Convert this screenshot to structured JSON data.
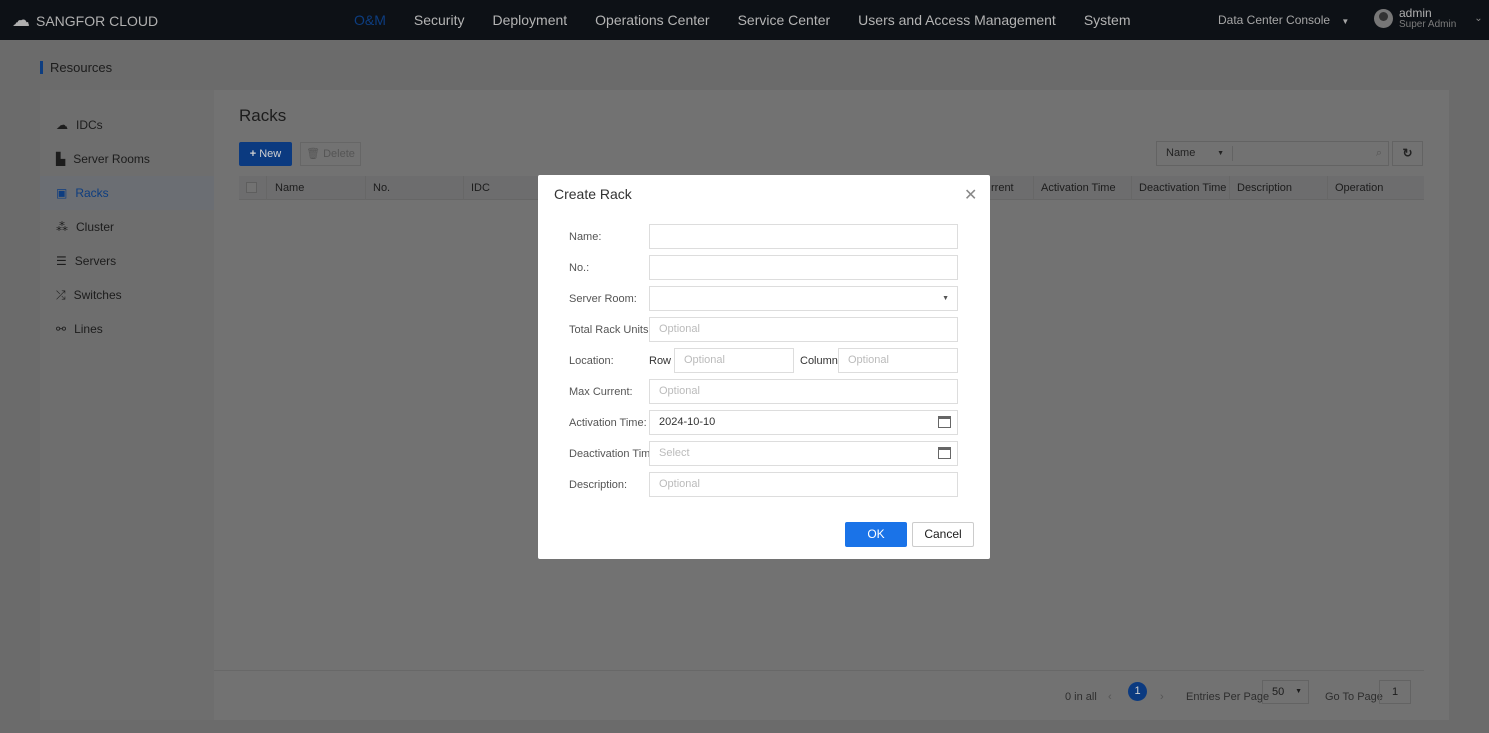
{
  "header": {
    "brand": "SANGFOR CLOUD",
    "nav": [
      "O&M",
      "Security",
      "Deployment",
      "Operations Center",
      "Service Center",
      "Users and Access Management",
      "System"
    ],
    "active_nav": "O&M",
    "console": "Data Center Console",
    "user": {
      "name": "admin",
      "role": "Super Admin"
    }
  },
  "breadcrumb": "Resources",
  "sidebar": {
    "items": [
      {
        "label": "IDCs",
        "icon": "cloud-icon"
      },
      {
        "label": "Server Rooms",
        "icon": "building-icon"
      },
      {
        "label": "Racks",
        "icon": "rack-icon",
        "active": true
      },
      {
        "label": "Cluster",
        "icon": "cluster-icon"
      },
      {
        "label": "Servers",
        "icon": "server-icon"
      },
      {
        "label": "Switches",
        "icon": "switch-icon"
      },
      {
        "label": "Lines",
        "icon": "lines-icon"
      }
    ]
  },
  "main": {
    "title": "Racks",
    "new_label": "New",
    "delete_label": "Delete",
    "search_field": "Name",
    "columns": [
      "Name",
      "No.",
      "IDC",
      "rrent",
      "Activation Time",
      "Deactivation Time",
      "Description",
      "Operation"
    ],
    "pager": {
      "total": "0 in all",
      "page": "1",
      "entries_label": "Entries Per Page",
      "entries": "50",
      "goto_label": "Go To Page",
      "goto": "1"
    }
  },
  "dialog": {
    "title": "Create Rack",
    "fields": {
      "name": "Name:",
      "no": "No.:",
      "server_room": "Server Room:",
      "total_units": "Total Rack Units:",
      "location": "Location:",
      "row": "Row",
      "column": "Column",
      "max_current": "Max Current:",
      "activation": "Activation Time:",
      "deactivation": "Deactivation Time:",
      "description": "Description:"
    },
    "placeholders": {
      "optional": "Optional",
      "select": "Select"
    },
    "activation_value": "2024-10-10",
    "ok": "OK",
    "cancel": "Cancel"
  },
  "colors": {
    "accent": "#1a73e8",
    "topbar": "#1b222c"
  }
}
